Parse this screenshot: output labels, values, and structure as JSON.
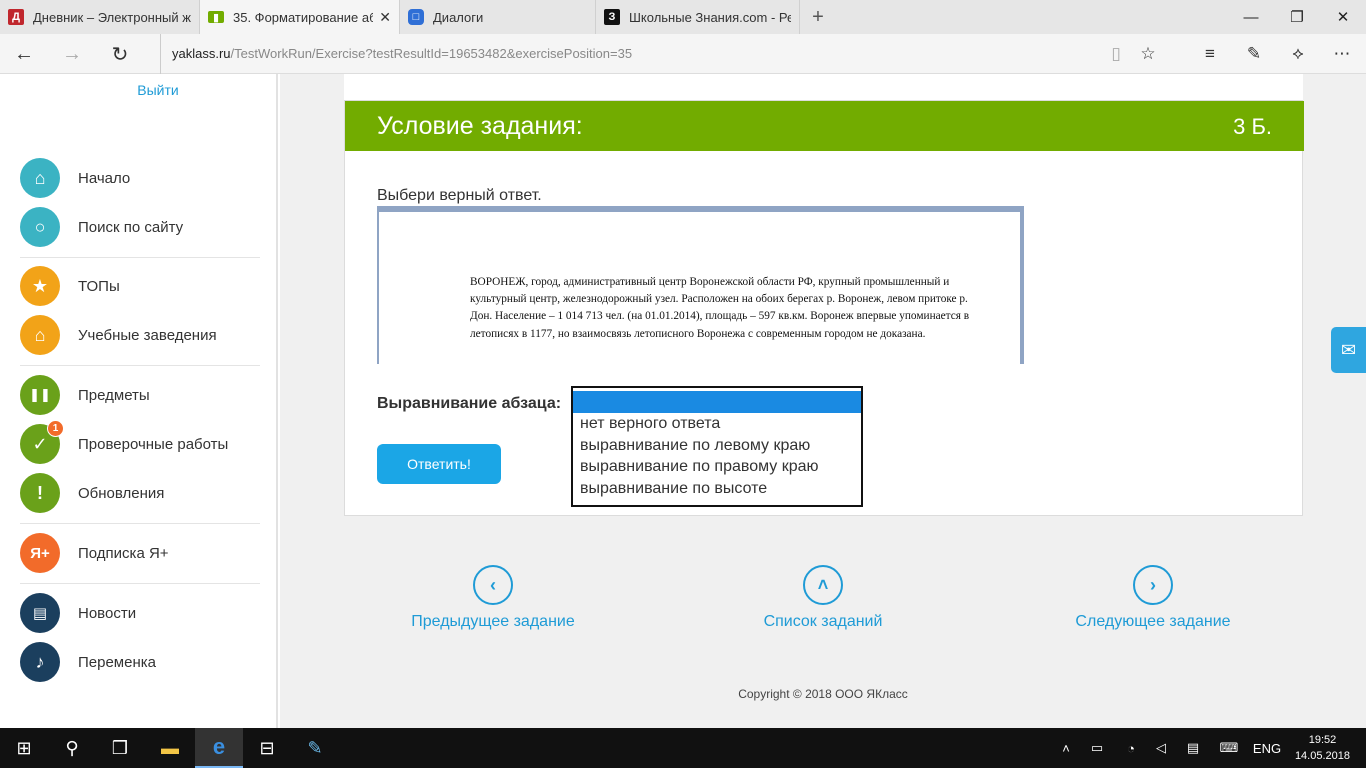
{
  "browser": {
    "tabs": [
      {
        "title": "Дневник – Электронный ж",
        "icon": "diary-icon",
        "color": "#c0272d",
        "glyph": "Д"
      },
      {
        "title": "35. Форматирование аб",
        "icon": "book-icon",
        "color": "#72ac00",
        "glyph": "▮"
      },
      {
        "title": "Диалоги",
        "icon": "chat-icon",
        "color": "#2f6fd6",
        "glyph": "□"
      },
      {
        "title": "Школьные Знания.com - Ре",
        "icon": "znanija-icon",
        "color": "#111111",
        "glyph": "З"
      }
    ],
    "address": {
      "host": "yaklass.ru",
      "path": "/TestWorkRun/Exercise?testResultId=19653482&exercisePosition=35"
    }
  },
  "sidebar": {
    "logout": "Выйти",
    "items": [
      {
        "label": "Начало",
        "icon": "home-icon",
        "color": "#3bb3c3",
        "glyph": "⌂"
      },
      {
        "label": "Поиск по сайту",
        "icon": "search-icon",
        "color": "#3bb3c3",
        "glyph": "○"
      },
      {
        "label": "ТОПы",
        "icon": "star-icon",
        "color": "#f2a318",
        "glyph": "★"
      },
      {
        "label": "Учебные заведения",
        "icon": "building-icon",
        "color": "#f2a318",
        "glyph": "⌂"
      },
      {
        "label": "Предметы",
        "icon": "open-book-icon",
        "color": "#6aa11a",
        "glyph": "❚❚"
      },
      {
        "label": "Проверочные работы",
        "icon": "check-icon",
        "color": "#6aa11a",
        "glyph": "✓",
        "badge": "1"
      },
      {
        "label": "Обновления",
        "icon": "exclamation-icon",
        "color": "#6aa11a",
        "glyph": "!"
      },
      {
        "label": "Подписка Я+",
        "icon": "ya-plus-icon",
        "color": "#f26b2a",
        "glyph": "Я+"
      },
      {
        "label": "Новости",
        "icon": "news-chat-icon",
        "color": "#1b3f5e",
        "glyph": "▤"
      },
      {
        "label": "Переменка",
        "icon": "bell-icon",
        "color": "#1b3f5e",
        "glyph": "♪"
      }
    ]
  },
  "task": {
    "title": "Условие задания:",
    "points": "3 Б.",
    "instruction": "Выбери верный ответ.",
    "document_text": "ВОРОНЕЖ, город, административный центр Воронежской области РФ, крупный промышленный и культурный центр, железнодорожный узел. Расположен на обоих берегах р. Воронеж, левом притоке р. Дон. Население – 1 014 713 чел. (на 01.01.2014), площадь – 597 кв.км. Воронеж впервые упоминается в летописях в 1177, но взаимосвязь летописного Воронежа с современным городом не доказана.",
    "question_label": "Выравнивание абзаца:",
    "answer_button": "Ответить!",
    "options": [
      "нет верного ответа",
      "выравнивание по левому краю",
      "выравнивание по правому краю",
      "выравнивание по высоте"
    ]
  },
  "pager": {
    "prev": "Предыдущее задание",
    "list": "Список заданий",
    "next": "Следующее задание"
  },
  "footer": {
    "copyright": "Copyright © 2018 ООО ЯКласс"
  },
  "taskbar": {
    "lang": "ENG",
    "time": "19:52",
    "date": "14.05.2018"
  }
}
